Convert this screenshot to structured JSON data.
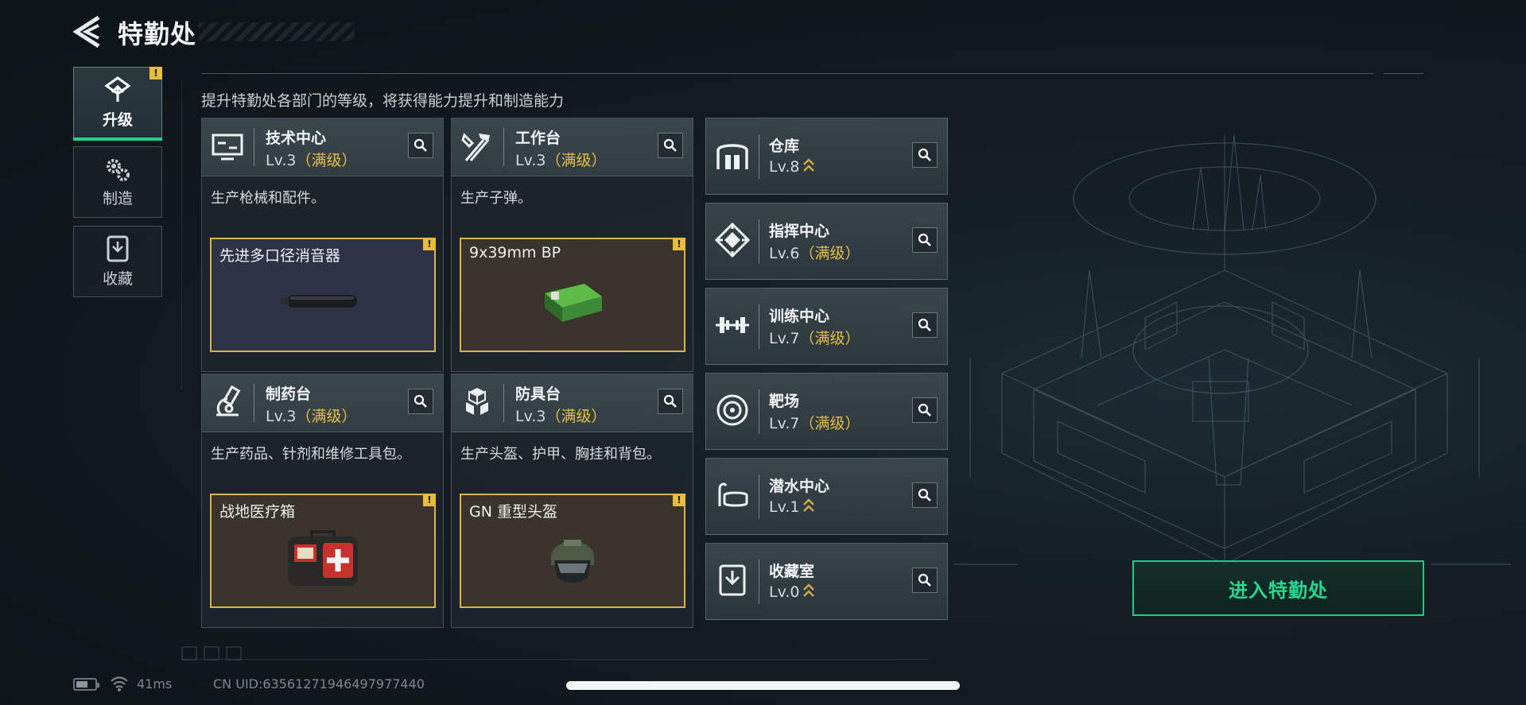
{
  "header": {
    "title": "特勤处"
  },
  "nav": {
    "tabs": [
      {
        "label": "升级",
        "icon": "upgrade-icon",
        "active": true,
        "alert": "!"
      },
      {
        "label": "制造",
        "icon": "gears-icon",
        "active": false
      },
      {
        "label": "收藏",
        "icon": "collection-icon",
        "active": false
      }
    ]
  },
  "intro": "提升特勤处各部门的等级，将获得能力提升和制造能力",
  "facilities": [
    {
      "name": "技术中心",
      "level": "Lv.3",
      "max": "（满级）",
      "desc": "生产枪械和配件。",
      "icon": "tech-center-icon",
      "craft": {
        "item": "先进多口径消音器",
        "alert": "!",
        "image": "suppressor-icon"
      }
    },
    {
      "name": "工作台",
      "level": "Lv.3",
      "max": "（满级）",
      "desc": "生产子弹。",
      "icon": "hammer-wrench-icon",
      "craft": {
        "item": "9x39mm BP",
        "alert": "!",
        "image": "ammo-box-icon"
      }
    },
    {
      "name": "制药台",
      "level": "Lv.3",
      "max": "（满级）",
      "desc": "生产药品、针剂和维修工具包。",
      "icon": "microscope-icon",
      "craft": {
        "item": "战地医疗箱",
        "alert": "!",
        "image": "medkit-icon"
      }
    },
    {
      "name": "防具台",
      "level": "Lv.3",
      "max": "（满级）",
      "desc": "生产头盔、护甲、胸挂和背包。",
      "icon": "armor-cubes-icon",
      "craft": {
        "item": "GN 重型头盔",
        "alert": "!",
        "image": "helmet-icon"
      }
    }
  ],
  "side_facilities": [
    {
      "name": "仓库",
      "level": "Lv.8",
      "max": "",
      "upgradable": true,
      "icon": "warehouse-icon"
    },
    {
      "name": "指挥中心",
      "level": "Lv.6",
      "max": "（满级）",
      "upgradable": false,
      "icon": "command-center-icon"
    },
    {
      "name": "训练中心",
      "level": "Lv.7",
      "max": "（满级）",
      "upgradable": false,
      "icon": "dumbbell-icon"
    },
    {
      "name": "靶场",
      "level": "Lv.7",
      "max": "（满级）",
      "upgradable": false,
      "icon": "target-icon"
    },
    {
      "name": "潜水中心",
      "level": "Lv.1",
      "max": "",
      "upgradable": true,
      "icon": "diving-mask-icon"
    },
    {
      "name": "收藏室",
      "level": "Lv.0",
      "max": "",
      "upgradable": true,
      "icon": "collection-room-icon"
    }
  ],
  "enter_button": "进入特勤处",
  "status": {
    "ping": "41ms",
    "uid": "CN UID:635612719464979774​40"
  },
  "colors": {
    "accent_green": "#21c98a",
    "max_gold": "#e6bd46",
    "alert_yellow": "#e7be3a",
    "slot_border": "#d8b548"
  }
}
